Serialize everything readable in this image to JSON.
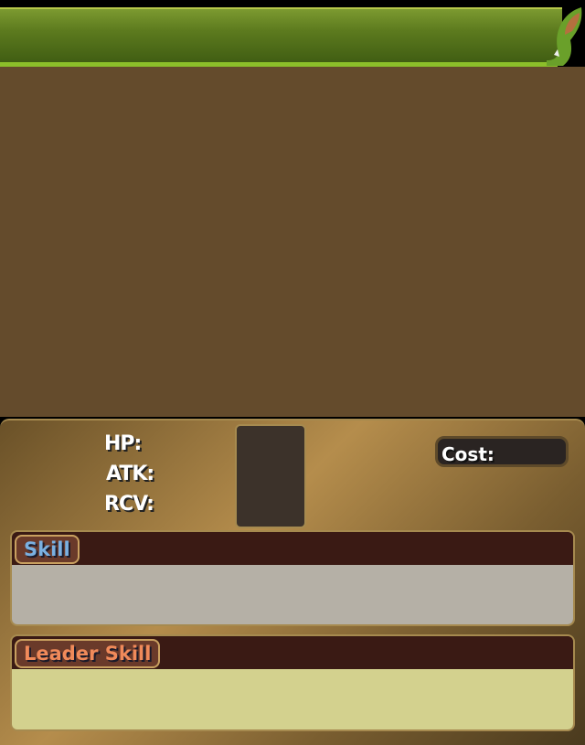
{
  "stats": {
    "hp_label": "HP:",
    "atk_label": "ATK:",
    "rcv_label": "RCV:",
    "cost_label": "Cost:"
  },
  "skill": {
    "label": "Skill"
  },
  "leader_skill": {
    "label": "Leader Skill"
  },
  "colors": {
    "banner": "#5c7a1e",
    "skill_body": "#b5b0a6",
    "leader_body": "#d3d18e"
  }
}
